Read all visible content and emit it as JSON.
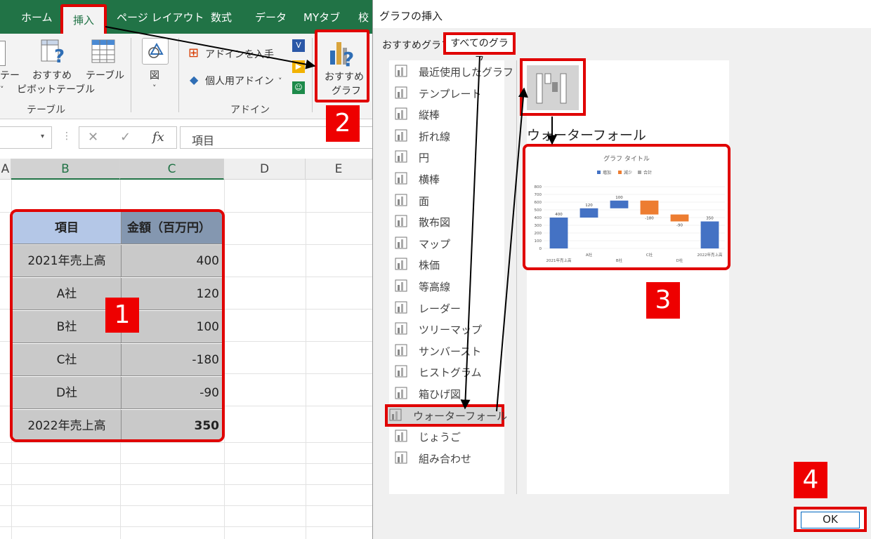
{
  "ribbon": {
    "tabs": [
      "ホーム",
      "挿入",
      "ページ レイアウト",
      "数式",
      "データ",
      "MYタブ",
      "校"
    ],
    "active_tab": "挿入",
    "buttons": {
      "partial_left": "テー",
      "rec_pivot_line1": "おすすめ",
      "rec_pivot_line2": "ピボットテーブル",
      "table": "テーブル",
      "figure": "図",
      "get_addins": "アドインを入手",
      "personal_addins": "個人用アドイン",
      "rec_charts_line1": "おすすめ",
      "rec_charts_line2": "グラフ"
    },
    "groups": {
      "table": "テーブル",
      "addins": "アドイン"
    }
  },
  "formula_bar": {
    "fx": "fx",
    "content": "項目"
  },
  "sheet": {
    "columns": [
      "A",
      "B",
      "C",
      "D",
      "E"
    ],
    "header": [
      "項目",
      "金額（百万円）"
    ],
    "rows": [
      {
        "label": "2021年売上高",
        "value": "400"
      },
      {
        "label": "A社",
        "value": "120"
      },
      {
        "label": "B社",
        "value": "100"
      },
      {
        "label": "C社",
        "value": "-180"
      },
      {
        "label": "D社",
        "value": "-90"
      },
      {
        "label": "2022年売上高",
        "value": "350"
      }
    ]
  },
  "dialog": {
    "title": "グラフの挿入",
    "tabs": {
      "recommended": "おすすめグラフ",
      "all": "すべてのグラフ"
    },
    "chart_types": [
      {
        "label": "最近使用したグラフ",
        "icon": "recent-icon"
      },
      {
        "label": "テンプレート",
        "icon": "folder-icon"
      },
      {
        "label": "縦棒",
        "icon": "column-chart-icon"
      },
      {
        "label": "折れ線",
        "icon": "line-chart-icon"
      },
      {
        "label": "円",
        "icon": "pie-chart-icon"
      },
      {
        "label": "横棒",
        "icon": "bar-chart-icon"
      },
      {
        "label": "面",
        "icon": "area-chart-icon"
      },
      {
        "label": "散布図",
        "icon": "scatter-chart-icon"
      },
      {
        "label": "マップ",
        "icon": "map-chart-icon"
      },
      {
        "label": "株価",
        "icon": "stock-chart-icon"
      },
      {
        "label": "等高線",
        "icon": "surface-chart-icon"
      },
      {
        "label": "レーダー",
        "icon": "radar-chart-icon"
      },
      {
        "label": "ツリーマップ",
        "icon": "treemap-icon"
      },
      {
        "label": "サンバースト",
        "icon": "sunburst-icon"
      },
      {
        "label": "ヒストグラム",
        "icon": "histogram-icon"
      },
      {
        "label": "箱ひげ図",
        "icon": "boxplot-icon"
      },
      {
        "label": "ウォーターフォール",
        "icon": "waterfall-icon"
      },
      {
        "label": "じょうご",
        "icon": "funnel-icon"
      },
      {
        "label": "組み合わせ",
        "icon": "combo-chart-icon"
      }
    ],
    "selected_type": "ウォーターフォール",
    "subtype_title": "ウォーターフォール",
    "ok": "OK"
  },
  "steps": [
    "1",
    "2",
    "3",
    "4"
  ],
  "colors": {
    "increase": "#4472c4",
    "decrease": "#ed7d31",
    "total": "#a5a5a5",
    "highlight": "#e00000",
    "excel_green": "#217346"
  },
  "chart_data": {
    "type": "bar",
    "subtype": "waterfall",
    "title": "グラフ タイトル",
    "legend": [
      "増加",
      "減少",
      "合計"
    ],
    "legend_position": "top",
    "categories": [
      "2021年売上高",
      "A社",
      "B社",
      "C社",
      "D社",
      "2022年売上高"
    ],
    "values": [
      400,
      120,
      100,
      -180,
      -90,
      350
    ],
    "data_labels": [
      "400",
      "120",
      "100",
      "-180",
      "-90",
      "350"
    ],
    "kinds": [
      "increase",
      "increase",
      "increase",
      "decrease",
      "decrease",
      "increase"
    ],
    "ylim": [
      0,
      800
    ],
    "yticks": [
      "800",
      "700",
      "600",
      "500",
      "400",
      "300",
      "200",
      "100",
      "0"
    ],
    "grid": true
  }
}
